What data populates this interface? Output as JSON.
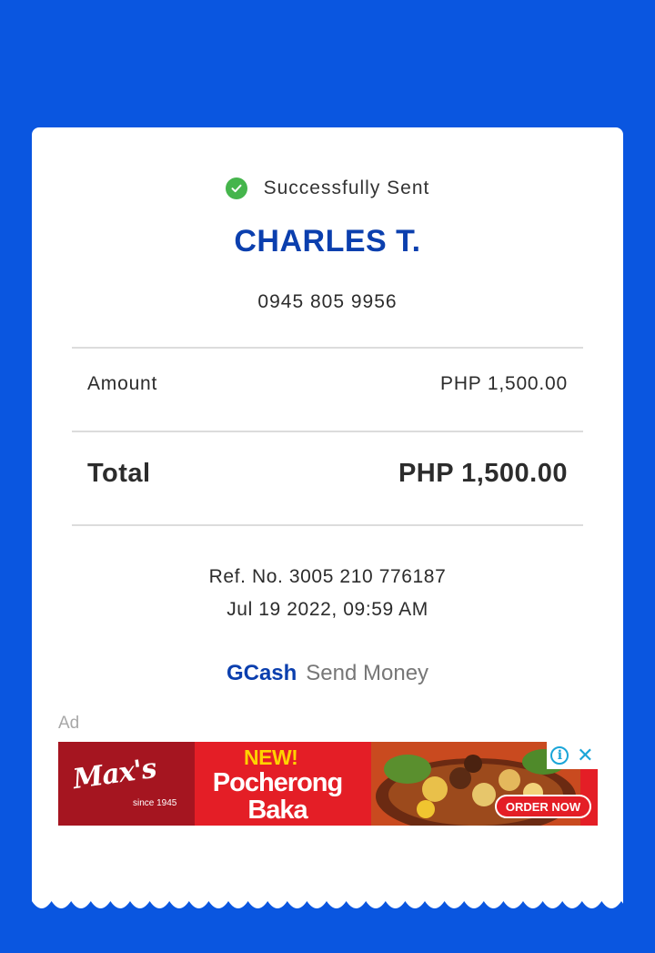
{
  "receipt": {
    "status": "Successfully Sent",
    "recipient_name": "CHARLES T.",
    "recipient_number": "0945 805 9956",
    "amount_label": "Amount",
    "amount_value": "PHP 1,500.00",
    "total_label": "Total",
    "total_value": "PHP 1,500.00",
    "ref_no": "Ref. No. 3005 210 776187",
    "datetime": "Jul 19 2022, 09:59 AM",
    "brand": "GCash",
    "service": "Send Money"
  },
  "ad": {
    "label": "Ad",
    "brand_logo": "Max's",
    "since": "since 1945",
    "tagline": "NEW!",
    "product": "Pocherong Baka",
    "cta": "ORDER NOW",
    "info_icon": "info-icon",
    "close_icon": "close-icon"
  },
  "colors": {
    "background": "#0a56e0",
    "brand_blue": "#0b3fae",
    "success_green": "#45b54c",
    "ad_red": "#e41e26"
  }
}
